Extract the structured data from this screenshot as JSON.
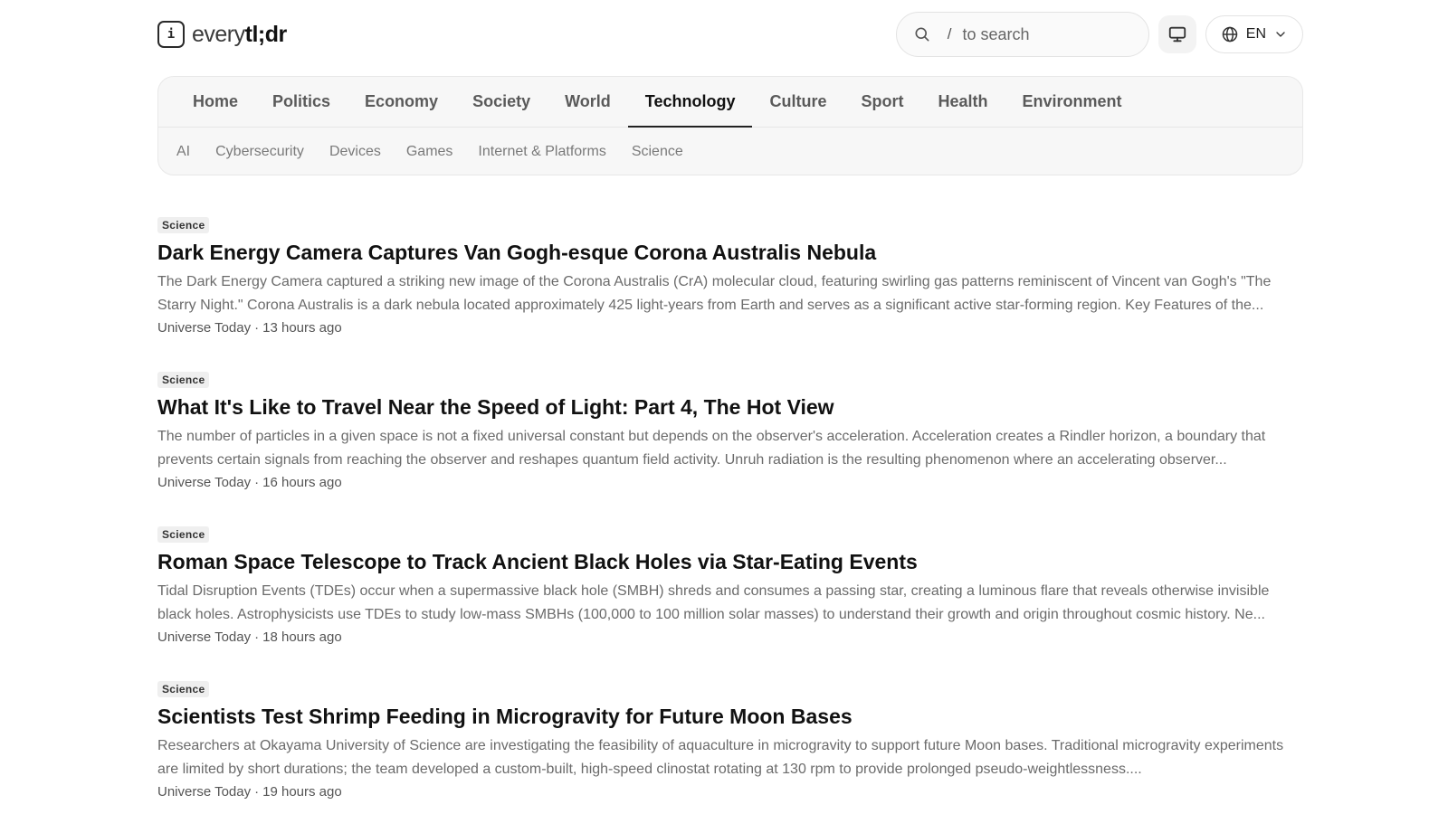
{
  "header": {
    "logo_prefix": "every",
    "logo_strong": "tl;dr",
    "logo_mark": "i",
    "search": {
      "shortcut": "/",
      "placeholder": "to search"
    },
    "language": "EN"
  },
  "nav": {
    "main_tabs": [
      {
        "label": "Home"
      },
      {
        "label": "Politics"
      },
      {
        "label": "Economy"
      },
      {
        "label": "Society"
      },
      {
        "label": "World"
      },
      {
        "label": "Technology",
        "active": true
      },
      {
        "label": "Culture"
      },
      {
        "label": "Sport"
      },
      {
        "label": "Health"
      },
      {
        "label": "Environment"
      }
    ],
    "sub_tabs": [
      {
        "label": "AI"
      },
      {
        "label": "Cybersecurity"
      },
      {
        "label": "Devices"
      },
      {
        "label": "Games"
      },
      {
        "label": "Internet & Platforms"
      },
      {
        "label": "Science"
      }
    ]
  },
  "articles": [
    {
      "tag": "Science",
      "title": "Dark Energy Camera Captures Van Gogh-esque Corona Australis Nebula",
      "summary": "The Dark Energy Camera captured a striking new image of the Corona Australis (CrA) molecular cloud, featuring swirling gas patterns reminiscent of Vincent van Gogh's \"The Starry Night.\" Corona Australis is a dark nebula located approximately 425 light-years from Earth and serves as a significant active star-forming region. Key Features of the...",
      "source": "Universe Today",
      "time": "13 hours ago"
    },
    {
      "tag": "Science",
      "title": "What It's Like to Travel Near the Speed of Light: Part 4, The Hot View",
      "summary": "The number of particles in a given space is not a fixed universal constant but depends on the observer's acceleration. Acceleration creates a Rindler horizon, a boundary that prevents certain signals from reaching the observer and reshapes quantum field activity. Unruh radiation is the resulting phenomenon where an accelerating observer...",
      "source": "Universe Today",
      "time": "16 hours ago"
    },
    {
      "tag": "Science",
      "title": "Roman Space Telescope to Track Ancient Black Holes via Star-Eating Events",
      "summary": "Tidal Disruption Events (TDEs) occur when a supermassive black hole (SMBH) shreds and consumes a passing star, creating a luminous flare that reveals otherwise invisible black holes. Astrophysicists use TDEs to study low-mass SMBHs (100,000 to 100 million solar masses) to understand their growth and origin throughout cosmic history. Ne...",
      "source": "Universe Today",
      "time": "18 hours ago"
    },
    {
      "tag": "Science",
      "title": "Scientists Test Shrimp Feeding in Microgravity for Future Moon Bases",
      "summary": "Researchers at Okayama University of Science are investigating the feasibility of aquaculture in microgravity to support future Moon bases. Traditional microgravity experiments are limited by short durations; the team developed a custom-built, high-speed clinostat rotating at 130 rpm to provide prolonged pseudo-weightlessness....",
      "source": "Universe Today",
      "time": "19 hours ago"
    }
  ]
}
